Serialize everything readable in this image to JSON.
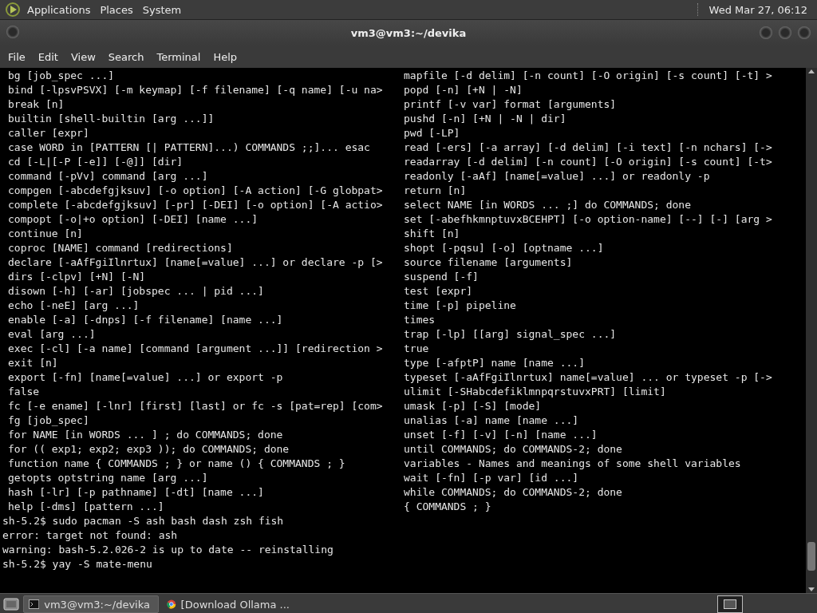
{
  "top_panel": {
    "menus": [
      "Applications",
      "Places",
      "System"
    ],
    "clock": "Wed Mar 27, 06:12"
  },
  "window": {
    "title": "vm3@vm3:~/devika"
  },
  "menu_bar": [
    "File",
    "Edit",
    "View",
    "Search",
    "Terminal",
    "Help"
  ],
  "terminal": {
    "left_column": [
      "bg [job_spec ...]",
      "bind [-lpsvPSVX] [-m keymap] [-f filename] [-q name] [-u na>",
      "break [n]",
      "builtin [shell-builtin [arg ...]]",
      "caller [expr]",
      "case WORD in [PATTERN [| PATTERN]...) COMMANDS ;;]... esac",
      "cd [-L|[-P [-e]] [-@]] [dir]",
      "command [-pVv] command [arg ...]",
      "compgen [-abcdefgjksuv] [-o option] [-A action] [-G globpat>",
      "complete [-abcdefgjksuv] [-pr] [-DEI] [-o option] [-A actio>",
      "compopt [-o|+o option] [-DEI] [name ...]",
      "continue [n]",
      "coproc [NAME] command [redirections]",
      "declare [-aAfFgiIlnrtux] [name[=value] ...] or declare -p [>",
      "dirs [-clpv] [+N] [-N]",
      "disown [-h] [-ar] [jobspec ... | pid ...]",
      "echo [-neE] [arg ...]",
      "enable [-a] [-dnps] [-f filename] [name ...]",
      "eval [arg ...]",
      "exec [-cl] [-a name] [command [argument ...]] [redirection >",
      "exit [n]",
      "export [-fn] [name[=value] ...] or export -p",
      "false",
      "fc [-e ename] [-lnr] [first] [last] or fc -s [pat=rep] [com>",
      "fg [job_spec]",
      "for NAME [in WORDS ... ] ; do COMMANDS; done",
      "for (( exp1; exp2; exp3 )); do COMMANDS; done",
      "function name { COMMANDS ; } or name () { COMMANDS ; }",
      "getopts optstring name [arg ...]",
      "hash [-lr] [-p pathname] [-dt] [name ...]",
      "help [-dms] [pattern ...]"
    ],
    "right_column": [
      "mapfile [-d delim] [-n count] [-O origin] [-s count] [-t] >",
      "popd [-n] [+N | -N]",
      "printf [-v var] format [arguments]",
      "pushd [-n] [+N | -N | dir]",
      "pwd [-LP]",
      "read [-ers] [-a array] [-d delim] [-i text] [-n nchars] [->",
      "readarray [-d delim] [-n count] [-O origin] [-s count] [-t>",
      "readonly [-aAf] [name[=value] ...] or readonly -p",
      "return [n]",
      "select NAME [in WORDS ... ;] do COMMANDS; done",
      "set [-abefhkmnptuvxBCEHPT] [-o option-name] [--] [-] [arg >",
      "shift [n]",
      "shopt [-pqsu] [-o] [optname ...]",
      "source filename [arguments]",
      "suspend [-f]",
      "test [expr]",
      "time [-p] pipeline",
      "times",
      "trap [-lp] [[arg] signal_spec ...]",
      "true",
      "type [-afptP] name [name ...]",
      "typeset [-aAfFgiIlnrtux] name[=value] ... or typeset -p [->",
      "ulimit [-SHabcdefiklmnpqrstuvxPRT] [limit]",
      "umask [-p] [-S] [mode]",
      "unalias [-a] name [name ...]",
      "unset [-f] [-v] [-n] [name ...]",
      "until COMMANDS; do COMMANDS-2; done",
      "variables - Names and meanings of some shell variables",
      "wait [-fn] [-p var] [id ...]",
      "while COMMANDS; do COMMANDS-2; done",
      "{ COMMANDS ; }"
    ],
    "output_lines": [
      "sh-5.2$ sudo pacman -S ash bash dash zsh fish",
      "error: target not found: ash",
      "warning: bash-5.2.026-2 is up to date -- reinstalling",
      "sh-5.2$ yay -S mate-menu"
    ]
  },
  "taskbar": {
    "tasks": [
      {
        "kind": "terminal",
        "label": "vm3@vm3:~/devika",
        "selected": true
      },
      {
        "kind": "browser",
        "label": "[Download Ollama ...",
        "selected": false
      }
    ]
  }
}
